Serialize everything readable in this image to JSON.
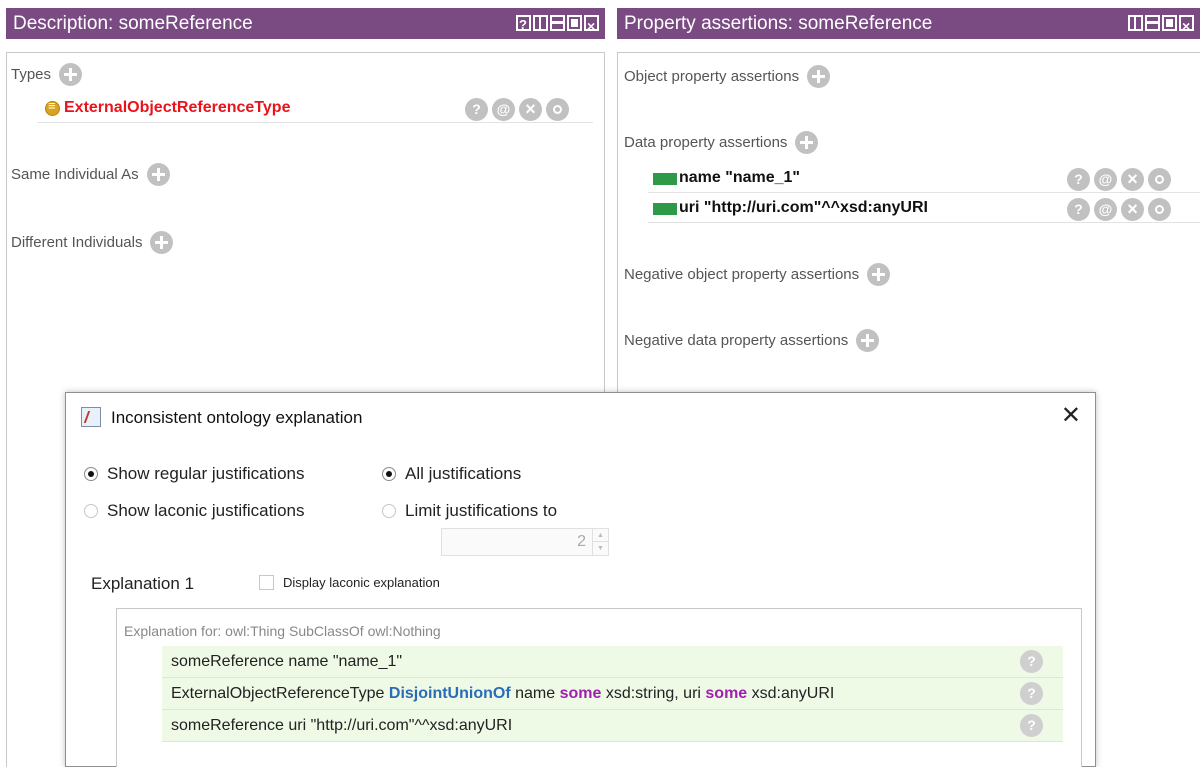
{
  "left_view": {
    "title": "Description: someReference",
    "sections": {
      "types": "Types",
      "same_individual": "Same Individual As",
      "different_individuals": "Different Individuals"
    },
    "type_entry": "ExternalObjectReferenceType"
  },
  "right_view": {
    "title": "Property assertions: someReference",
    "sections": {
      "object_props": "Object property assertions",
      "data_props": "Data property assertions",
      "neg_object_props": "Negative object property assertions",
      "neg_data_props": "Negative data property assertions"
    },
    "data_assertions": [
      "name  \"name_1\"",
      "uri  \"http://uri.com\"^^xsd:anyURI"
    ]
  },
  "dialog": {
    "title": "Inconsistent ontology explanation",
    "close": "✕",
    "options": {
      "regular": "Show regular justifications",
      "laconic": "Show laconic justifications",
      "all": "All justifications",
      "limit": "Limit justifications to"
    },
    "limit_value": "2",
    "explanation_label": "Explanation 1",
    "laconic_checkbox": "Display laconic explanation",
    "explanation_for": "Explanation for: owl:Thing SubClassOf owl:Nothing",
    "axioms": {
      "a1": "someReference name \"name_1\"",
      "a2_p1": "ExternalObjectReferenceType ",
      "a2_kw1": "DisjointUnionOf",
      "a2_p2": " name ",
      "a2_kw2": "some",
      "a2_p3": " xsd:string, uri ",
      "a2_kw3": "some",
      "a2_p4": " xsd:anyURI",
      "a3": "someReference uri \"http://uri.com\"^^xsd:anyURI"
    }
  },
  "colors": {
    "header_purple": "#7a4b83",
    "type_red": "#e8141b",
    "data_green": "#2e9a47",
    "axiom_bg": "#eef9e6"
  }
}
